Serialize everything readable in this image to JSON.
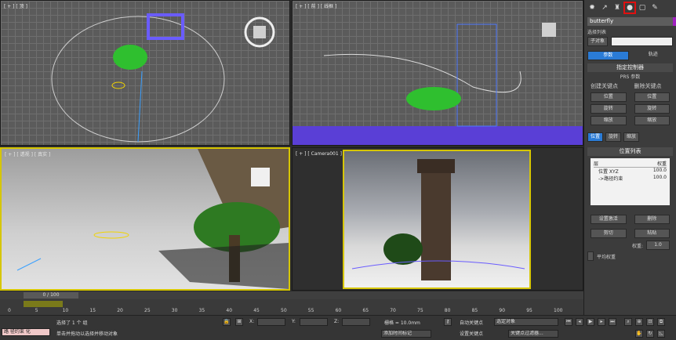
{
  "viewports": {
    "top_label": "[ + ] [ 顶 ]",
    "front_label": "[ + ] [ 前 ] [ 线框 ]",
    "persp_label": "[ + ] [ 透视 ] [ 真实 ]",
    "camera_label": "[ + ] [ Camera001 ] [ 真实 ]"
  },
  "command_panel": {
    "object_name": "butterfly",
    "selection_set_label": "选择列表",
    "selection_set_value": "子对象",
    "tabs": [
      "参数",
      "轨迹"
    ],
    "assign_controller": "指定控制器",
    "prs_title": "PRS 参数",
    "create_key_label": "创建关键点",
    "delete_key_label": "删除关键点",
    "prs_buttons": [
      "位置",
      "位置",
      "旋转",
      "旋转",
      "缩放",
      "缩放"
    ],
    "sub_tabs": [
      "位置",
      "旋转",
      "缩放"
    ],
    "position_list_title": "位置列表",
    "list_header_layer": "层",
    "list_header_weight": "权重",
    "list_items": [
      {
        "name": "位置 XYZ",
        "weight": "100.0"
      },
      {
        "name": "->路径约束",
        "weight": "100.0"
      }
    ],
    "btn_set_active": "设置激活",
    "btn_delete": "删除",
    "btn_cut": "剪切",
    "btn_paste": "粘贴",
    "weight_label": "权重:",
    "weight_value": "1.0",
    "avg_weight_label": "平均权重"
  },
  "timeline": {
    "frame_display": "0 / 100",
    "ticks": [
      "0",
      "5",
      "10",
      "15",
      "20",
      "25",
      "30",
      "35",
      "40",
      "45",
      "50",
      "55",
      "60",
      "65",
      "70",
      "75",
      "80",
      "85",
      "90",
      "95",
      "100"
    ]
  },
  "status": {
    "left_label": "路 径约束 化",
    "selected": "选择了 1 个 组",
    "hint": "单击并拖动以选择并移动对象",
    "x_label": "X:",
    "y_label": "Y:",
    "z_label": "Z:",
    "grid": "栅格 = 10.0mm",
    "add_time_tag": "添加时间标记",
    "auto_key": "自动关键点",
    "set_key": "设置关键点",
    "selected_objects": "选定对象",
    "key_filters": "关键点过滤器..."
  },
  "colors": {
    "accent_blue": "#2a7bd6",
    "active_yellow": "#d6c600",
    "highlight_red": "#e01010",
    "object_color": "#a020c0"
  }
}
